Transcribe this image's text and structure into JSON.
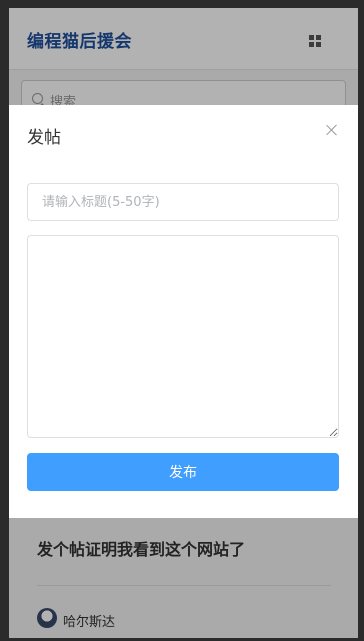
{
  "header": {
    "logo_text": "编程猫后援会",
    "menu_icon": "grid-icon"
  },
  "search": {
    "placeholder": "搜索"
  },
  "feed": {
    "post_title": "发个帖证明我看到这个网站了",
    "author": "哈尔斯达"
  },
  "modal": {
    "title": "发帖",
    "close_icon": "close-icon",
    "title_placeholder": "请输入标题(5-50字)",
    "body_value": "",
    "publish_label": "发布"
  },
  "colors": {
    "brand": "#1f4f9c",
    "primary_button": "#409eff"
  }
}
